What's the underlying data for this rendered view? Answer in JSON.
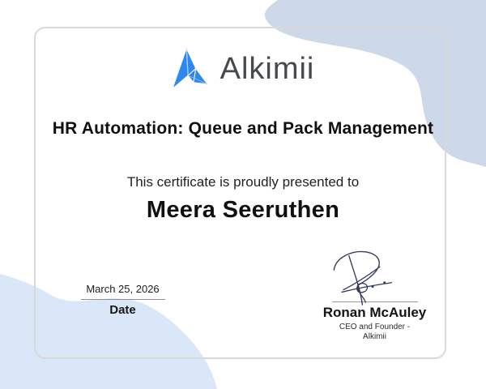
{
  "certificate": {
    "brand": "Alkimii",
    "course_title": "HR Automation: Queue and Pack Management",
    "presented_line": "This certificate is proudly presented to",
    "recipient_name": "Meera Seeruthen",
    "date": {
      "value": "March 25, 2026",
      "label": "Date"
    },
    "signatory": {
      "name": "Ronan McAuley",
      "role_line1": "CEO and Founder -",
      "role_line2": "Alkimii"
    }
  },
  "icons": {
    "logo_icon": "alkimii-faceted-arrow",
    "signature": "handwritten-signature"
  },
  "colors": {
    "brand_blue": "#2e87f0",
    "wordmark_gray": "#46494d",
    "ink_navy": "#333b5e",
    "blob_gray_blue": "#cdd8e8",
    "blob_light_blue": "#d9e7f8",
    "card_border": "#d9d9d9",
    "text_black": "#101010",
    "rule_gray": "#8f8f8f"
  }
}
